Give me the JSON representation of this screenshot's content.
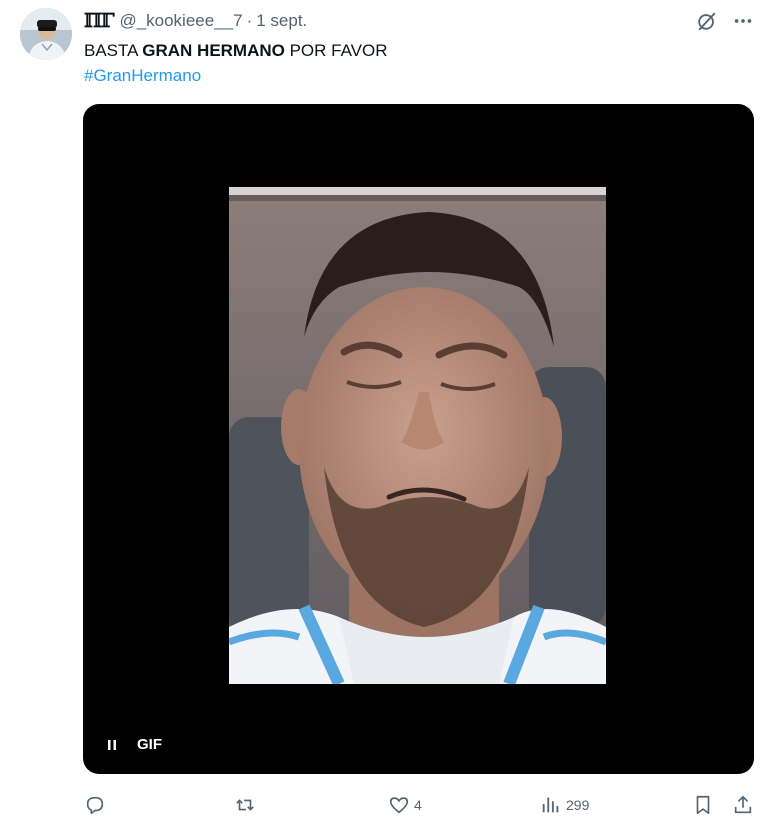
{
  "tweet": {
    "name_glyph": "ℿℾ",
    "handle": "@_kookieee__7",
    "separator": "·",
    "date": "1 sept.",
    "text_before": "BASTA ",
    "text_bold": "GRAN HERMANO",
    "text_after": " POR FAVOR",
    "hashtag": "#GranHermano"
  },
  "media": {
    "type_label": "GIF",
    "state": "playing"
  },
  "actions": {
    "reply_count": "",
    "retweet_count": "",
    "like_count": "4",
    "views_count": "299"
  },
  "icons": {
    "header": [
      "grok-icon",
      "more-icon"
    ],
    "actions": [
      "reply-icon",
      "retweet-icon",
      "like-icon",
      "views-icon",
      "bookmark-icon",
      "share-icon"
    ]
  }
}
